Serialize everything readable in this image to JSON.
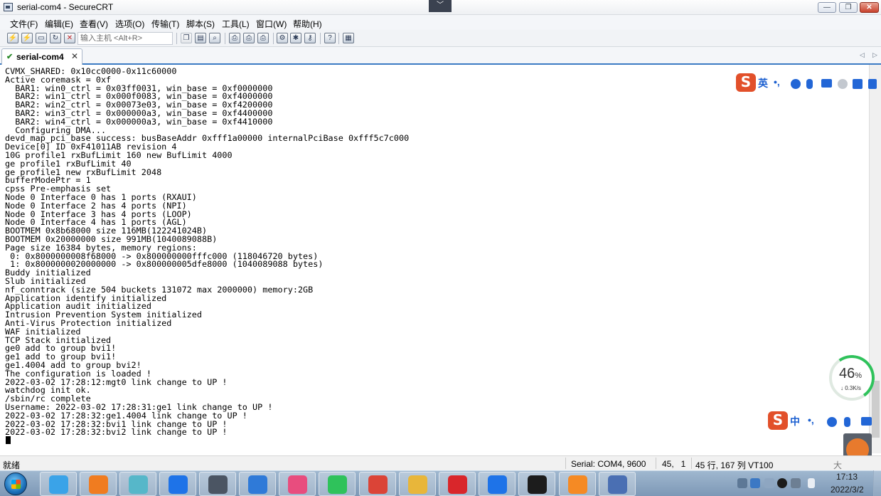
{
  "window": {
    "title": "serial-com4 - SecureCRT",
    "controls": {
      "minimize": "—",
      "maximize": "❐",
      "close": "✕"
    },
    "title_dropdown": "﹀"
  },
  "menu": {
    "items": [
      "文件(F)",
      "编辑(E)",
      "查看(V)",
      "选项(O)",
      "传输(T)",
      "脚本(S)",
      "工具(L)",
      "窗口(W)",
      "帮助(H)"
    ]
  },
  "toolbar": {
    "host_placeholder": "输入主机 <Alt+R>",
    "icons": [
      "connect-icon",
      "quick-connect-icon",
      "connect-tab-icon",
      "reconnect-icon",
      "disconnect-icon",
      "copy-icon",
      "paste-icon",
      "find-icon",
      "print-icon",
      "print-selection-icon",
      "print-setup-icon",
      "session-options-icon",
      "global-options-icon",
      "keymap-icon",
      "help-icon",
      "sftp-icon"
    ]
  },
  "tabs": [
    {
      "label": "serial-com4",
      "active": true,
      "status_icon": "✔",
      "close": "✕"
    }
  ],
  "tab_scroll": {
    "left": "◁",
    "right": "▷"
  },
  "terminal": {
    "lines": [
      "CVMX_SHARED: 0x10cc0000-0x11c60000",
      "Active coremask = 0xf",
      "  BAR1: win0_ctrl = 0x03ff0031, win_base = 0xf0000000",
      "  BAR2: win1_ctrl = 0x000f0083, win_base = 0xf4000000",
      "  BAR2: win2_ctrl = 0x00073e03, win_base = 0xf4200000",
      "  BAR2: win3_ctrl = 0x000000a3, win_base = 0xf4400000",
      "  BAR2: win4_ctrl = 0x000000a3, win_base = 0xf4410000",
      "  Configuring DMA...",
      "devd_map_pci_base success: busBaseAddr 0xfff1a00000 internalPciBase 0xfff5c7c000",
      "Device[0] ID 0xF41011AB revision 4",
      "10G profile1 rxBufLimit 160 new BufLimit 4000",
      "ge profile1 rxBufLimit 40",
      "ge profile1 new rxBufLimit 2048",
      "bufferModePtr = 1",
      "cpss Pre-emphasis set",
      "Node 0 Interface 0 has 1 ports (RXAUI)",
      "Node 0 Interface 2 has 4 ports (NPI)",
      "Node 0 Interface 3 has 4 ports (LOOP)",
      "Node 0 Interface 4 has 1 ports (AGL)",
      "BOOTMEM 0x8b68000 size 116MB(122241024B)",
      "BOOTMEM 0x20000000 size 991MB(1040089088B)",
      "Page size 16384 bytes, memory regions:",
      " 0: 0x8000000008f68000 -> 0x800000000fffc000 (118046720 bytes)",
      " 1: 0x8000000020000000 -> 0x800000005dfe8000 (1040089088 bytes)",
      "Buddy initialized",
      "Slub initialized",
      "nf_conntrack (size 504 buckets 131072 max 2000000) memory:2GB",
      "Application identify initialized",
      "Application audit initialized",
      "Intrusion Prevention System initialized",
      "Anti-Virus Protection initialized",
      "WAF initialized",
      "TCP Stack initialized",
      "ge0 add to group bvi1!",
      "ge1 add to group bvi1!",
      "ge1.4004 add to group bvi2!",
      "The configuration is loaded !",
      "2022-03-02 17:28:12:mgt0 link change to UP !",
      "watchdog init ok.",
      "/sbin/rc complete",
      "Username: 2022-03-02 17:28:31:ge1 link change to UP !",
      "2022-03-02 17:28:32:ge1.4004 link change to UP !",
      "2022-03-02 17:28:32:bvi1 link change to UP !",
      "2022-03-02 17:28:32:bvi2 link change to UP !"
    ]
  },
  "status": {
    "ready": "就绪",
    "connection": "Serial: COM4, 9600",
    "cursor_pos": "45,   1",
    "dimensions": "45 行, 167 列 VT100",
    "extra": "大"
  },
  "ime_top": {
    "logo": "S",
    "lang": "英",
    "punct": "•,",
    "icons": [
      "emoji-icon",
      "mic-icon",
      "keyboard-icon",
      "user-icon",
      "skin-icon",
      "toolbox-icon"
    ]
  },
  "ime_bottom": {
    "logo": "S",
    "lang": "中",
    "punct": "•,",
    "icons": [
      "emoji-icon",
      "mic-icon",
      "keyboard-icon"
    ]
  },
  "net_widget": {
    "percent": "46",
    "percent_unit": "%",
    "speed": "↓ 0.3K/s"
  },
  "taskbar": {
    "apps": [
      "qq-browser-icon",
      "firefox-icon",
      "notepad-icon",
      "dingtalk-icon",
      "securecrt-icon",
      "network-tool-icon",
      "colorful-app-icon",
      "wechat-icon",
      "chrome-icon",
      "file-explorer-icon",
      "wps-icon",
      "feishu-icon",
      "terminal-icon",
      "settings-app-icon",
      "remote-desktop-icon"
    ],
    "app_colors": [
      "#3aa3e8",
      "#f07c20",
      "#56b7c9",
      "#1e73e8",
      "#4b5563",
      "#2f7ad8",
      "#e84d7e",
      "#2fc25b",
      "#db4437",
      "#e8b63a",
      "#d9262b",
      "#1e73e8",
      "#1c1c1c",
      "#f58a24",
      "#4a6fb3"
    ],
    "clock_time": "17:13",
    "clock_date": "2022/3/2"
  }
}
